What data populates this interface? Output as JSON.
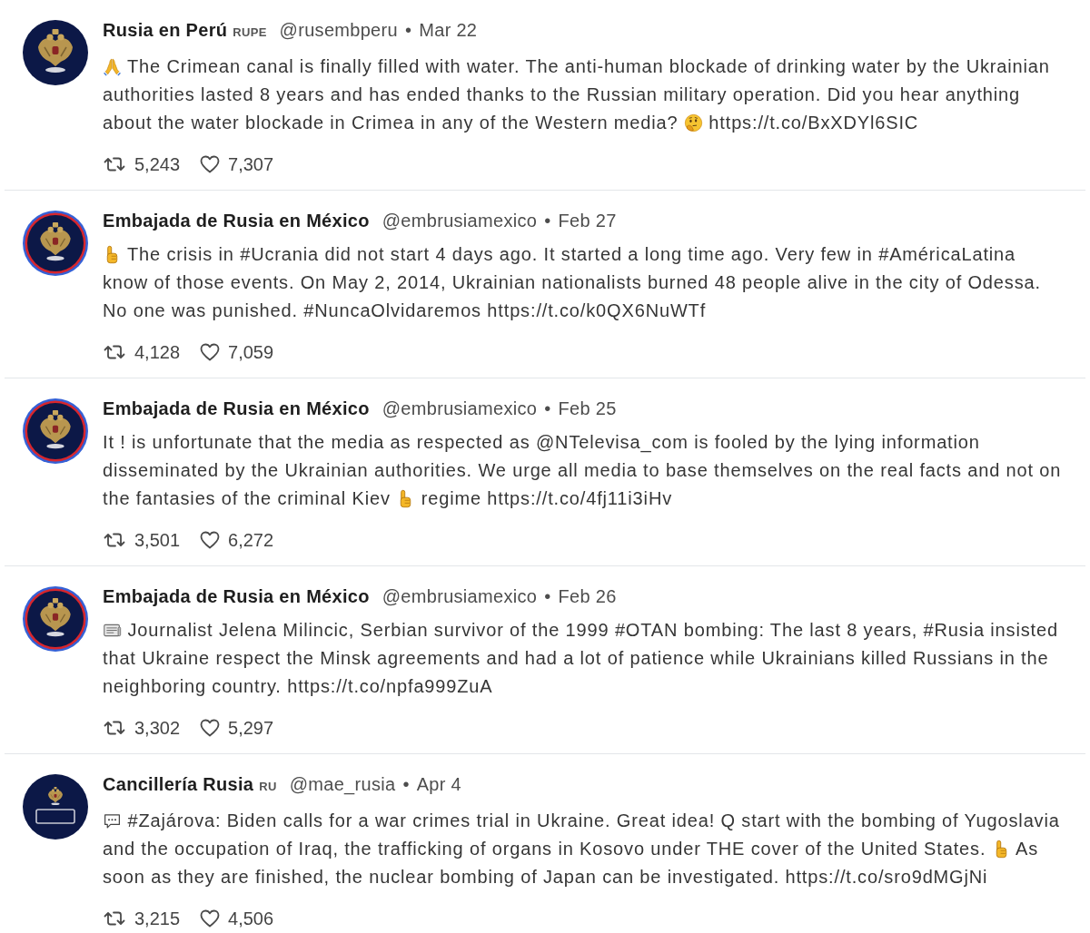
{
  "tweets": [
    {
      "avatar": {
        "kind": "plain"
      },
      "name": "Rusia en Perú",
      "flag": "RUPE",
      "handle": "@rusembperu",
      "separator": "•",
      "date": "Mar 22",
      "body": [
        {
          "kind": "pray"
        },
        {
          "kind": "text",
          "text": "The Crimean canal is finally filled with water. The anti-human blockade of drinking water by the Ukrainian authorities lasted 8 years and has ended thanks to the Russian military operation. Did you hear anything about the water blockade in Crimea in any of the Western media?"
        },
        {
          "kind": "think"
        },
        {
          "kind": "text",
          "text": "https://t.co/BxXDYl6SIC"
        }
      ],
      "retweets": "5,243",
      "likes": "7,307"
    },
    {
      "avatar": {
        "kind": "ringed"
      },
      "name": "Embajada de Rusia en México",
      "handle": "@embrusiamexico",
      "separator": "•",
      "date": "Feb 27",
      "body": [
        {
          "kind": "point"
        },
        {
          "kind": "text",
          "text": "The crisis in #Ucrania did not start 4 days ago. It started a long time ago. Very few in #AméricaLatina know of those events. On May 2, 2014, Ukrainian nationalists burned 48 people alive in the city of Odessa. No one was punished. #NuncaOlvidaremos https://t.co/k0QX6NuWTf"
        }
      ],
      "retweets": "4,128",
      "likes": "7,059"
    },
    {
      "avatar": {
        "kind": "ringed"
      },
      "name": "Embajada de Rusia en México",
      "handle": "@embrusiamexico",
      "separator": "•",
      "date": "Feb 25",
      "body": [
        {
          "kind": "text",
          "text": "It ! is unfortunate that the media as respected as @NTelevisa_com is fooled by the lying information disseminated by the Ukrainian authorities. We urge all media to base themselves on the real facts and not on the fantasies of the criminal Kiev"
        },
        {
          "kind": "point"
        },
        {
          "kind": "text",
          "text": "regime https://t.co/4fj11i3iHv"
        }
      ],
      "retweets": "3,501",
      "likes": "6,272"
    },
    {
      "avatar": {
        "kind": "ringed"
      },
      "name": "Embajada de Rusia en México",
      "handle": "@embrusiamexico",
      "separator": "•",
      "date": "Feb 26",
      "body": [
        {
          "kind": "news"
        },
        {
          "kind": "text",
          "text": "Journalist Jelena Milincic, Serbian survivor of the 1999 #OTAN bombing: The last 8 years, #Rusia insisted that Ukraine respect the Minsk agreements and had a lot of patience while Ukrainians killed Russians in the neighboring country. https://t.co/npfa999ZuA"
        }
      ],
      "retweets": "3,302",
      "likes": "5,297"
    },
    {
      "avatar": {
        "kind": "badge"
      },
      "name": "Cancillería Rusia",
      "flag": "RU",
      "handle": "@mae_rusia",
      "separator": "•",
      "date": "Apr 4",
      "body": [
        {
          "kind": "speech"
        },
        {
          "kind": "text",
          "text": "#Zajárova: Biden calls for a war crimes trial in Ukraine. Great idea! Q start with the bombing of Yugoslavia and the occupation of Iraq, the trafficking of organs in Kosovo under THE cover of the United States."
        },
        {
          "kind": "point"
        },
        {
          "kind": "text",
          "text": "As soon as they are finished, the nuclear bombing of Japan can be investigated. https://t.co/sro9dMGjNi"
        }
      ],
      "retweets": "3,215",
      "likes": "4,506"
    }
  ]
}
